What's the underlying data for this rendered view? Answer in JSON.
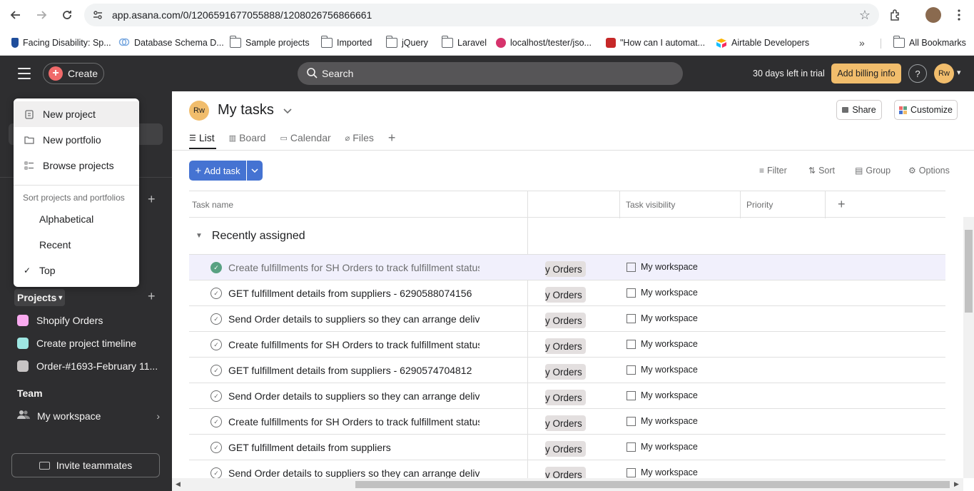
{
  "browser": {
    "url": "app.asana.com/0/1206591677055888/1208026756866661",
    "bookmarks": [
      {
        "label": "Facing Disability: Sp...",
        "icon": "bookmark-favicon-icon"
      },
      {
        "label": "Database Schema D...",
        "icon": "cloud-favicon-icon"
      },
      {
        "label": "Sample projects",
        "icon": "folder-icon"
      },
      {
        "label": "Imported",
        "icon": "folder-icon"
      },
      {
        "label": "jQuery",
        "icon": "folder-icon"
      },
      {
        "label": "Laravel",
        "icon": "folder-icon"
      },
      {
        "label": "localhost/tester/jso...",
        "icon": "localhost-favicon-icon"
      },
      {
        "label": "\"How can I automat...",
        "icon": "stack-favicon-icon"
      },
      {
        "label": "Airtable Developers",
        "icon": "airtable-favicon-icon"
      }
    ],
    "all_bookmarks": "All Bookmarks"
  },
  "topbar": {
    "create_label": "Create",
    "search_placeholder": "Search",
    "trial_text": "30 days left in trial",
    "billing_label": "Add billing info",
    "help_label": "?",
    "avatar_initials": "Rw"
  },
  "sidebar": {
    "projects_label": "Projects",
    "projects": [
      {
        "name": "Shopify Orders",
        "color": "#f9aaef"
      },
      {
        "name": "Create project timeline",
        "color": "#9ee7e3"
      },
      {
        "name": "Order-#1693-February 11...",
        "color": "#c7c4c4"
      }
    ],
    "team_label": "Team",
    "workspace_label": "My workspace",
    "invite_label": "Invite teammates"
  },
  "dropdown": {
    "items": [
      {
        "label": "New project",
        "icon": "clipboard-icon"
      },
      {
        "label": "New portfolio",
        "icon": "folder-icon"
      },
      {
        "label": "Browse projects",
        "icon": "list-icon"
      }
    ],
    "sort_heading": "Sort projects and portfolios",
    "sort_options": [
      {
        "label": "Alphabetical",
        "checked": false
      },
      {
        "label": "Recent",
        "checked": false
      },
      {
        "label": "Top",
        "checked": true
      }
    ]
  },
  "main": {
    "avatar_initials": "Rw",
    "title": "My tasks",
    "share_label": "Share",
    "customize_label": "Customize",
    "tabs": [
      "List",
      "Board",
      "Calendar",
      "Files"
    ],
    "add_task_label": "Add task",
    "tools": [
      "Filter",
      "Sort",
      "Group",
      "Options"
    ],
    "columns": [
      "Task name",
      "Task visibility",
      "Priority"
    ],
    "section_title": "Recently assigned",
    "tasks": [
      {
        "name": "Create fulfillments for SH Orders to track fulfillment status",
        "project": "y Orders",
        "visibility": "My workspace",
        "done": true
      },
      {
        "name": "GET fulfillment details from suppliers - 6290588074156",
        "project": "y Orders",
        "visibility": "My workspace",
        "done": false
      },
      {
        "name": "Send Order details to suppliers so they can arrange delivery",
        "project": "y Orders",
        "visibility": "My workspace",
        "done": false
      },
      {
        "name": "Create fulfillments for SH Orders to track fulfillment status",
        "project": "y Orders",
        "visibility": "My workspace",
        "done": false
      },
      {
        "name": "GET fulfillment details from suppliers - 6290574704812",
        "project": "y Orders",
        "visibility": "My workspace",
        "done": false
      },
      {
        "name": "Send Order details to suppliers so they can arrange delivery",
        "project": "y Orders",
        "visibility": "My workspace",
        "done": false
      },
      {
        "name": "Create fulfillments for SH Orders to track fulfillment status",
        "project": "y Orders",
        "visibility": "My workspace",
        "done": false
      },
      {
        "name": "GET fulfillment details from suppliers",
        "project": "y Orders",
        "visibility": "My workspace",
        "done": false
      },
      {
        "name": "Send Order details to suppliers so they can arrange delivery",
        "project": "y Orders",
        "visibility": "My workspace",
        "done": false
      }
    ]
  }
}
